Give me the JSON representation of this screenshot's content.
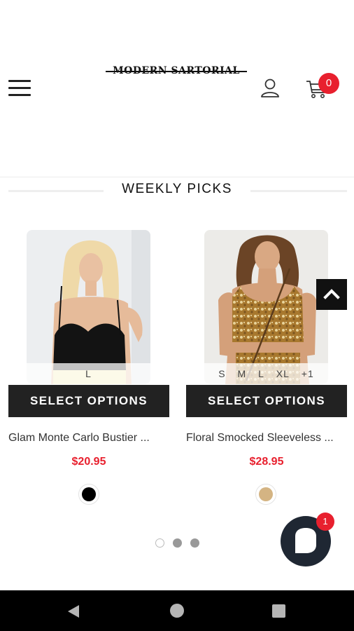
{
  "header": {
    "logo_text": "MODERN SARTORIAL",
    "cart_count": "0"
  },
  "section": {
    "title": "WEEKLY PICKS"
  },
  "products": [
    {
      "sizes": [
        "L"
      ],
      "button_label": "SELECT OPTIONS",
      "name": "Glam Monte Carlo Bustier ...",
      "price": "$20.95",
      "swatch_color": "#000000"
    },
    {
      "sizes": [
        "S",
        "M",
        "L",
        "XL",
        "+1"
      ],
      "button_label": "SELECT OPTIONS",
      "name": "Floral Smocked Sleeveless ...",
      "price": "$28.95",
      "swatch_color": "#d4b483"
    }
  ],
  "carousel": {
    "pages": 3,
    "active_page": 1
  },
  "chat": {
    "badge_count": "1"
  },
  "colors": {
    "accent_red": "#e8202e",
    "button_dark": "#222222"
  },
  "icons": [
    "hamburger-menu-icon",
    "user-icon",
    "cart-icon",
    "chevron-up-icon",
    "chat-icon",
    "back-triangle-icon",
    "home-circle-icon",
    "recents-square-icon"
  ]
}
